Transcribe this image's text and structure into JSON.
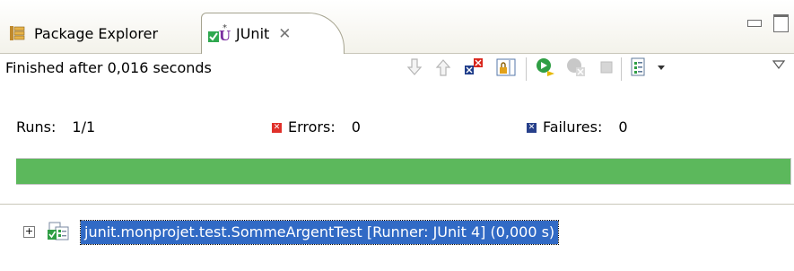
{
  "tabs": [
    {
      "label": "Package Explorer",
      "icon": "package-explorer-icon",
      "active": false
    },
    {
      "label": "JUnit",
      "icon": "junit-icon",
      "active": true
    }
  ],
  "status": {
    "text": "Finished after 0,016 seconds"
  },
  "toolbar": {
    "buttons": [
      "next-failure-icon",
      "previous-failure-icon",
      "show-failures-only-icon",
      "scroll-lock-icon",
      "rerun-test-icon",
      "rerun-failures-first-icon",
      "stop-icon",
      "test-run-history-icon",
      "dropdown-arrow-icon",
      "view-menu-icon"
    ]
  },
  "counters": {
    "runs_label": "Runs:",
    "runs_value": "1/1",
    "errors_label": "Errors:",
    "errors_value": "0",
    "failures_label": "Failures:",
    "failures_value": "0"
  },
  "progress": {
    "fraction": 1.0,
    "color": "#5cb85c"
  },
  "tree": {
    "items": [
      {
        "label": "junit.monprojet.test.SommeArgentTest [Runner: JUnit 4] (0,000 s)",
        "expanded": false,
        "selected": true
      }
    ]
  },
  "colors": {
    "selection": "#316ac5",
    "error": "#e0302a",
    "failure": "#27408b",
    "success": "#5cb85c"
  }
}
